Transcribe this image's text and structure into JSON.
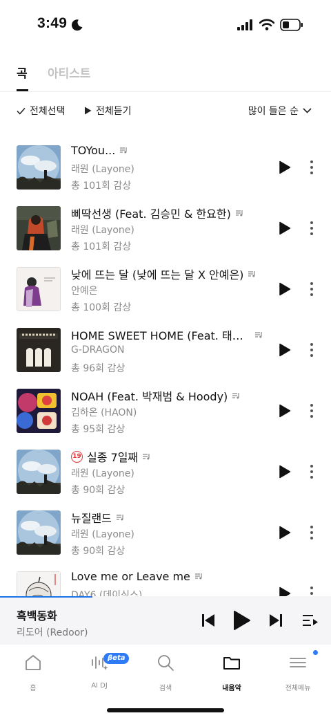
{
  "status_bar": {
    "time": "3:49"
  },
  "tabs": [
    {
      "label": "곡"
    },
    {
      "label": "아티스트"
    }
  ],
  "toolbar": {
    "select_all": "전체선택",
    "play_all": "전체듣기",
    "sort": "많이 들은 순"
  },
  "songs": [
    {
      "title": "TOYou...",
      "artist": "래원 (Layone)",
      "plays": "총 101회 감상",
      "explicit": false
    },
    {
      "title": "삐딱선생 (Feat. 김승민 & 한요한)",
      "artist": "래원 (Layone)",
      "plays": "총 101회 감상",
      "explicit": false
    },
    {
      "title": "낮에 뜨는 달 (낮에 뜨는 달 X 안예은)",
      "artist": "안예은",
      "plays": "총 100회 감상",
      "explicit": false
    },
    {
      "title": "HOME SWEET HOME (Feat. 태…",
      "artist": "G-DRAGON",
      "plays": "총 96회 감상",
      "explicit": false
    },
    {
      "title": "NOAH (Feat. 박재범 & Hoody)",
      "artist": "김하온 (HAON)",
      "plays": "총 95회 감상",
      "explicit": false
    },
    {
      "title": "실종 7일째",
      "artist": "래원 (Layone)",
      "plays": "총 90회 감상",
      "explicit": true,
      "age_badge": "19"
    },
    {
      "title": "뉴질랜드",
      "artist": "래원 (Layone)",
      "plays": "총 90회 감상",
      "explicit": false
    },
    {
      "title": "Love me or Leave me",
      "artist": "DAY6 (데이식스)",
      "plays": "",
      "explicit": false
    }
  ],
  "mini_player": {
    "title": "흑백동화",
    "artist": "리도어 (Redoor)",
    "progress": 0.28
  },
  "nav": [
    {
      "label": "홈"
    },
    {
      "label": "AI DJ",
      "badge": "βeta"
    },
    {
      "label": "검색"
    },
    {
      "label": "내음악"
    },
    {
      "label": "전체메뉴"
    }
  ],
  "colors": {
    "accent": "#2f7bf6",
    "explicit": "#e8393a",
    "text_secondary": "#8a8a8a"
  }
}
